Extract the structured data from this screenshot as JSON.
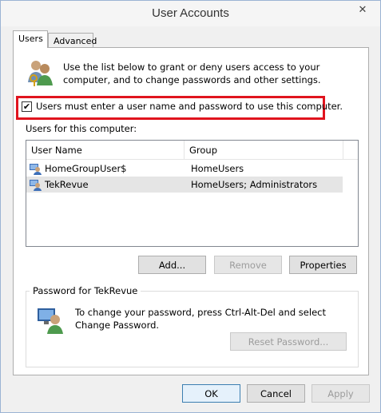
{
  "window": {
    "title": "User Accounts",
    "close_glyph": "✕"
  },
  "tabs": [
    {
      "label": "Users",
      "active": true
    },
    {
      "label": "Advanced",
      "active": false
    }
  ],
  "intro_text": "Use the list below to grant or deny users access to your computer, and to change passwords and other settings.",
  "must_login": {
    "label": "Users must enter a user name and password to use this computer.",
    "checked": true,
    "check_glyph": "✔"
  },
  "users_list": {
    "caption": "Users for this computer:",
    "columns": [
      "User Name",
      "Group"
    ],
    "rows": [
      {
        "name": "HomeGroupUser$",
        "group": "HomeUsers",
        "icon": "user-icon"
      },
      {
        "name": "TekRevue",
        "group": "HomeUsers; Administrators",
        "icon": "user-icon"
      }
    ]
  },
  "buttons": {
    "add": "Add...",
    "remove": "Remove",
    "properties": "Properties",
    "reset_password": "Reset Password...",
    "ok": "OK",
    "cancel": "Cancel",
    "apply": "Apply"
  },
  "password_group": {
    "legend": "Password for TekRevue",
    "text": "To change your password, press Ctrl-Alt-Del and select Change Password."
  },
  "colors": {
    "highlight": "#e0141e",
    "selected_row": "#e5e5e5",
    "default_button": "#3c7fb1"
  }
}
